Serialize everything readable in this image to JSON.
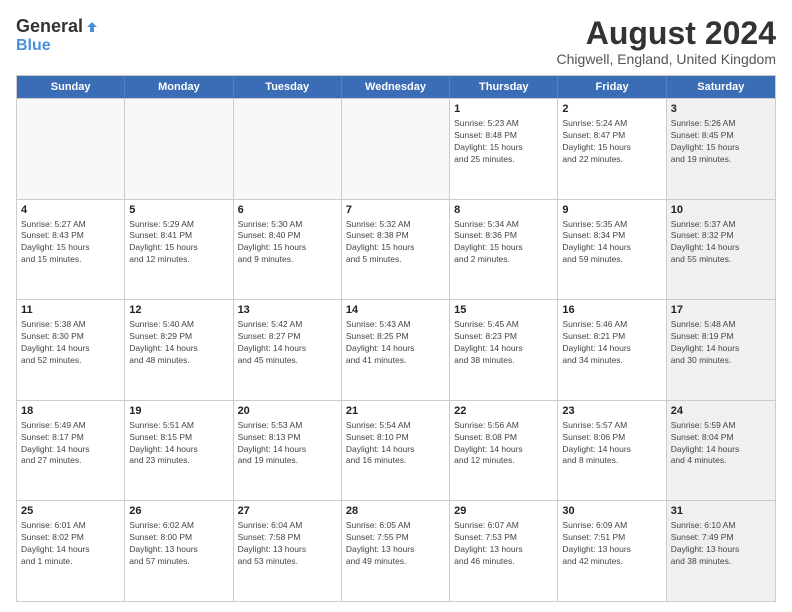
{
  "header": {
    "logo_general": "General",
    "logo_blue": "Blue",
    "month_year": "August 2024",
    "location": "Chigwell, England, United Kingdom"
  },
  "days_of_week": [
    "Sunday",
    "Monday",
    "Tuesday",
    "Wednesday",
    "Thursday",
    "Friday",
    "Saturday"
  ],
  "weeks": [
    [
      {
        "day": "",
        "info": "",
        "empty": true
      },
      {
        "day": "",
        "info": "",
        "empty": true
      },
      {
        "day": "",
        "info": "",
        "empty": true
      },
      {
        "day": "",
        "info": "",
        "empty": true
      },
      {
        "day": "1",
        "info": "Sunrise: 5:23 AM\nSunset: 8:48 PM\nDaylight: 15 hours\nand 25 minutes."
      },
      {
        "day": "2",
        "info": "Sunrise: 5:24 AM\nSunset: 8:47 PM\nDaylight: 15 hours\nand 22 minutes."
      },
      {
        "day": "3",
        "info": "Sunrise: 5:26 AM\nSunset: 8:45 PM\nDaylight: 15 hours\nand 19 minutes.",
        "shaded": true
      }
    ],
    [
      {
        "day": "4",
        "info": "Sunrise: 5:27 AM\nSunset: 8:43 PM\nDaylight: 15 hours\nand 15 minutes."
      },
      {
        "day": "5",
        "info": "Sunrise: 5:29 AM\nSunset: 8:41 PM\nDaylight: 15 hours\nand 12 minutes."
      },
      {
        "day": "6",
        "info": "Sunrise: 5:30 AM\nSunset: 8:40 PM\nDaylight: 15 hours\nand 9 minutes."
      },
      {
        "day": "7",
        "info": "Sunrise: 5:32 AM\nSunset: 8:38 PM\nDaylight: 15 hours\nand 5 minutes."
      },
      {
        "day": "8",
        "info": "Sunrise: 5:34 AM\nSunset: 8:36 PM\nDaylight: 15 hours\nand 2 minutes."
      },
      {
        "day": "9",
        "info": "Sunrise: 5:35 AM\nSunset: 8:34 PM\nDaylight: 14 hours\nand 59 minutes."
      },
      {
        "day": "10",
        "info": "Sunrise: 5:37 AM\nSunset: 8:32 PM\nDaylight: 14 hours\nand 55 minutes.",
        "shaded": true
      }
    ],
    [
      {
        "day": "11",
        "info": "Sunrise: 5:38 AM\nSunset: 8:30 PM\nDaylight: 14 hours\nand 52 minutes."
      },
      {
        "day": "12",
        "info": "Sunrise: 5:40 AM\nSunset: 8:29 PM\nDaylight: 14 hours\nand 48 minutes."
      },
      {
        "day": "13",
        "info": "Sunrise: 5:42 AM\nSunset: 8:27 PM\nDaylight: 14 hours\nand 45 minutes."
      },
      {
        "day": "14",
        "info": "Sunrise: 5:43 AM\nSunset: 8:25 PM\nDaylight: 14 hours\nand 41 minutes."
      },
      {
        "day": "15",
        "info": "Sunrise: 5:45 AM\nSunset: 8:23 PM\nDaylight: 14 hours\nand 38 minutes."
      },
      {
        "day": "16",
        "info": "Sunrise: 5:46 AM\nSunset: 8:21 PM\nDaylight: 14 hours\nand 34 minutes."
      },
      {
        "day": "17",
        "info": "Sunrise: 5:48 AM\nSunset: 8:19 PM\nDaylight: 14 hours\nand 30 minutes.",
        "shaded": true
      }
    ],
    [
      {
        "day": "18",
        "info": "Sunrise: 5:49 AM\nSunset: 8:17 PM\nDaylight: 14 hours\nand 27 minutes."
      },
      {
        "day": "19",
        "info": "Sunrise: 5:51 AM\nSunset: 8:15 PM\nDaylight: 14 hours\nand 23 minutes."
      },
      {
        "day": "20",
        "info": "Sunrise: 5:53 AM\nSunset: 8:13 PM\nDaylight: 14 hours\nand 19 minutes."
      },
      {
        "day": "21",
        "info": "Sunrise: 5:54 AM\nSunset: 8:10 PM\nDaylight: 14 hours\nand 16 minutes."
      },
      {
        "day": "22",
        "info": "Sunrise: 5:56 AM\nSunset: 8:08 PM\nDaylight: 14 hours\nand 12 minutes."
      },
      {
        "day": "23",
        "info": "Sunrise: 5:57 AM\nSunset: 8:06 PM\nDaylight: 14 hours\nand 8 minutes."
      },
      {
        "day": "24",
        "info": "Sunrise: 5:59 AM\nSunset: 8:04 PM\nDaylight: 14 hours\nand 4 minutes.",
        "shaded": true
      }
    ],
    [
      {
        "day": "25",
        "info": "Sunrise: 6:01 AM\nSunset: 8:02 PM\nDaylight: 14 hours\nand 1 minute."
      },
      {
        "day": "26",
        "info": "Sunrise: 6:02 AM\nSunset: 8:00 PM\nDaylight: 13 hours\nand 57 minutes."
      },
      {
        "day": "27",
        "info": "Sunrise: 6:04 AM\nSunset: 7:58 PM\nDaylight: 13 hours\nand 53 minutes."
      },
      {
        "day": "28",
        "info": "Sunrise: 6:05 AM\nSunset: 7:55 PM\nDaylight: 13 hours\nand 49 minutes."
      },
      {
        "day": "29",
        "info": "Sunrise: 6:07 AM\nSunset: 7:53 PM\nDaylight: 13 hours\nand 46 minutes."
      },
      {
        "day": "30",
        "info": "Sunrise: 6:09 AM\nSunset: 7:51 PM\nDaylight: 13 hours\nand 42 minutes."
      },
      {
        "day": "31",
        "info": "Sunrise: 6:10 AM\nSunset: 7:49 PM\nDaylight: 13 hours\nand 38 minutes.",
        "shaded": true
      }
    ]
  ]
}
